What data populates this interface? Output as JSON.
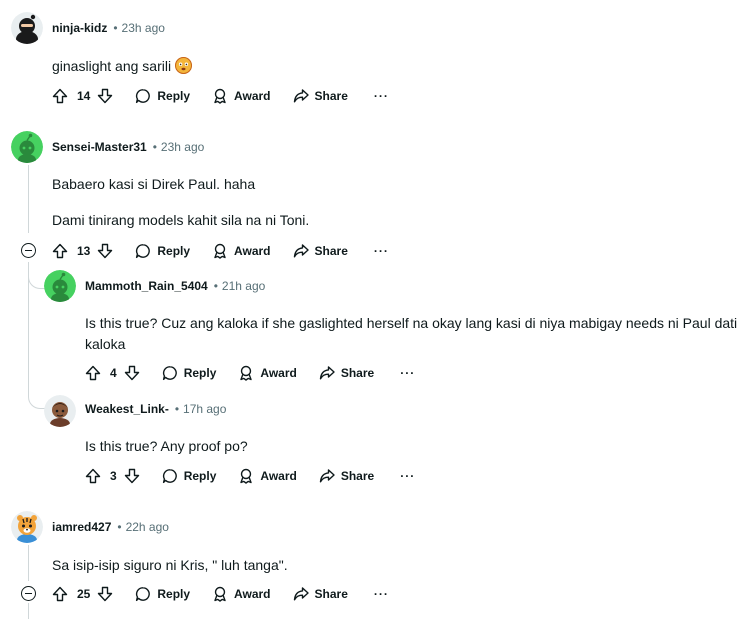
{
  "comments": [
    {
      "id": "c1",
      "username": "ninja-kidz",
      "time": "23h ago",
      "lines": [
        "ginaslight ang sarili"
      ],
      "emoji_icon": "flushed-face-emoji",
      "score": "14",
      "avatar_color": "#1a1a1b"
    },
    {
      "id": "c2",
      "username": "Sensei-Master31",
      "time": "23h ago",
      "lines": [
        "Babaero kasi si Direk Paul. haha",
        "Dami tinirang models kahit sila na ni Toni."
      ],
      "score": "13",
      "avatar_color": "#46d160"
    },
    {
      "id": "c3",
      "username": "Mammoth_Rain_5404",
      "time": "21h ago",
      "lines": [
        "Is this true? Cuz ang kaloka if she gaslighted herself na okay lang kasi di niya mabigay needs ni Paul dati",
        "kaloka"
      ],
      "score": "4",
      "avatar_color": "#46d160"
    },
    {
      "id": "c4",
      "username": "Weakest_Link-",
      "time": "17h ago",
      "lines": [
        "Is this true? Any proof po?"
      ],
      "score": "3",
      "avatar_color": "#6b3d2a"
    },
    {
      "id": "c5",
      "username": "iamred427",
      "time": "22h ago",
      "lines": [
        "Sa isip-isip siguro ni Kris, \" luh tanga\"."
      ],
      "score": "25",
      "avatar_color": "#f2a33a"
    }
  ],
  "actions": {
    "reply": "Reply",
    "award": "Award",
    "share": "Share",
    "more": "···"
  },
  "meta_separator": "•",
  "colors": {
    "thread_line": "#d0d7d9",
    "muted_text": "#576f76",
    "text": "#0f1a1c"
  }
}
